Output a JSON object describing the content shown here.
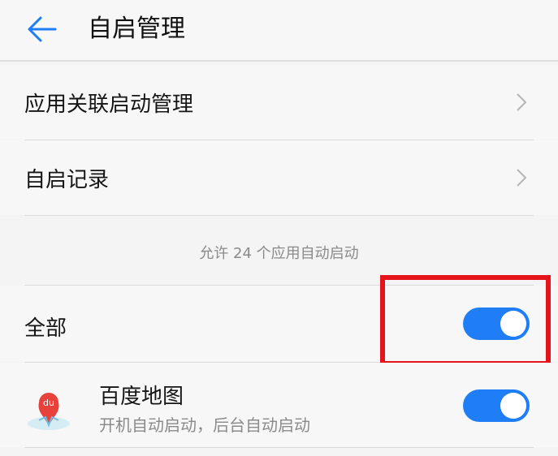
{
  "header": {
    "title": "自启管理",
    "back_icon": "back-arrow-icon"
  },
  "menu": {
    "items": [
      {
        "label": "应用关联启动管理",
        "icon": "chevron-right-icon"
      },
      {
        "label": "自启记录",
        "icon": "chevron-right-icon"
      }
    ]
  },
  "section": {
    "note": "允许 24 个应用自动启动"
  },
  "all_toggle": {
    "label": "全部",
    "enabled": true
  },
  "apps": [
    {
      "name": "百度地图",
      "subtitle": "开机自动启动，后台自动启动",
      "enabled": true
    }
  ],
  "colors": {
    "accent": "#1f7ef5",
    "highlight": "#e5141b",
    "secondary_text": "#8a8a8a"
  }
}
